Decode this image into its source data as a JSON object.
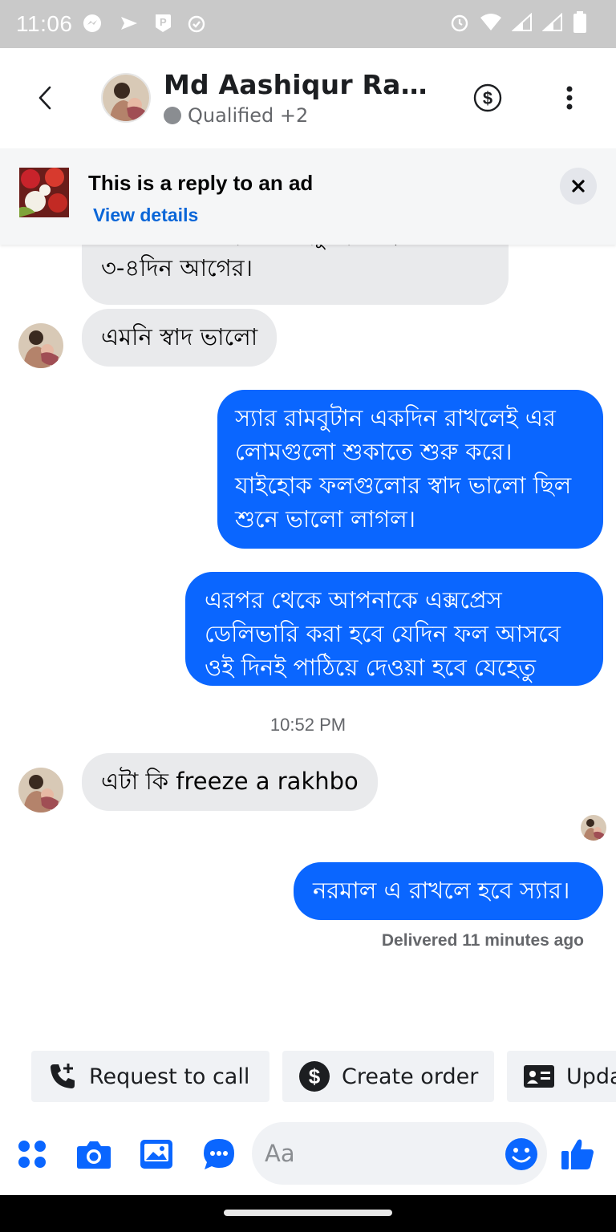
{
  "status_bar": {
    "time": "11:06"
  },
  "header": {
    "contact_name": "Md Aashiqur Rahm...",
    "contact_status": "Qualified +2",
    "icons": [
      "back-icon",
      "dollar-icon",
      "more-icon"
    ]
  },
  "ad_banner": {
    "title": "This is a reply to an ad",
    "link": "View details"
  },
  "messages": [
    {
      "direction": "in",
      "text": "পাবেনা ফ্রেশ হবে যেহেতু হয়েছে"
    },
    {
      "direction": "in",
      "text": "৩-৪দিন আগের।"
    },
    {
      "direction": "in",
      "text": "এমনি স্বাদ ভালো"
    },
    {
      "direction": "out",
      "lines": [
        "স্যার রামবুটান একদিন রাখলেই এর",
        "লোমগুলো শুকাতে শুরু করে।",
        "যাইহোক ফলগুলোর স্বাদ ভালো ছিল",
        "শুনে ভালো লাগল।"
      ]
    },
    {
      "direction": "out",
      "lines": [
        "এরপর থেকে আপনাকে এক্সপ্রেস",
        "ডেলিভারি করা হবে যেদিন ফল আসবে",
        "ওই দিনই পাঠিয়ে দেওয়া হবে যেহেতু"
      ]
    },
    {
      "direction": "in",
      "text": "এটা কি freeze a rakhbo"
    },
    {
      "direction": "out",
      "text": "নরমাল এ রাখলে হবে স্যার।"
    }
  ],
  "timestamp": "10:52 PM",
  "delivered": "Delivered 11 minutes ago",
  "quick_actions": {
    "request_call": "Request to call",
    "create_order": "Create order",
    "update": "Upda"
  },
  "composer": {
    "placeholder": "Aa"
  },
  "colors": {
    "accent": "#0a66ff",
    "incoming_bubble": "#e9eaec",
    "link": "#0a66d8"
  }
}
